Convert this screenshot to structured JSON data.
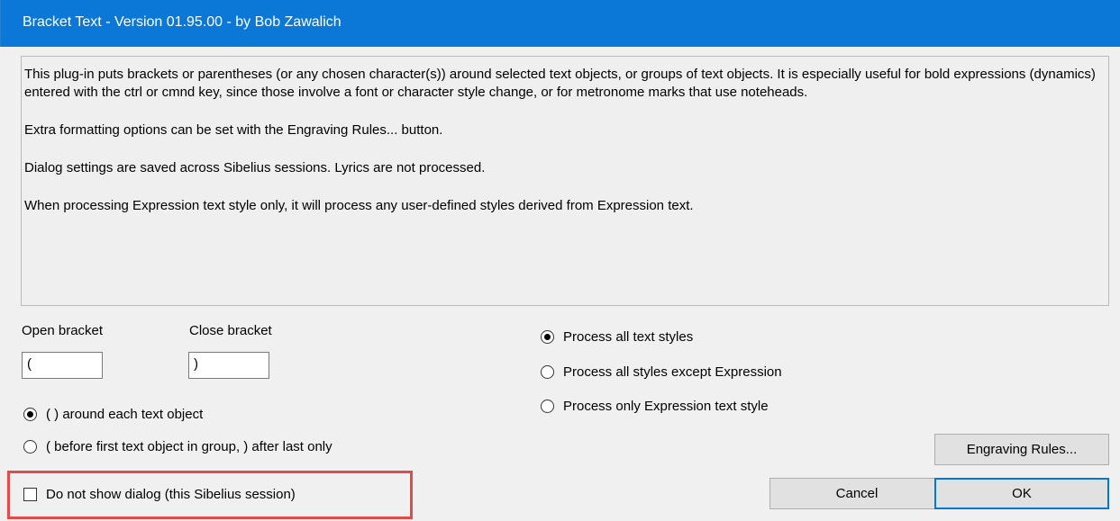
{
  "window": {
    "title": "Bracket Text - Version 01.95.00 - by Bob Zawalich"
  },
  "description": {
    "paragraphs": [
      "This plug-in puts brackets or parentheses (or any chosen character(s)) around selected text objects, or groups of text objects. It is especially useful for bold expressions (dynamics) entered with the ctrl or cmnd key, since those involve a font or character style change, or for metronome marks that use noteheads.",
      "Extra formatting options can be set with the Engraving Rules... button.",
      "Dialog settings are saved across Sibelius sessions. Lyrics are not processed.",
      "When processing Expression text style only, it will process any user-defined styles derived from Expression text."
    ]
  },
  "brackets": {
    "open_label": "Open bracket",
    "open_value": "(",
    "close_label": "Close bracket",
    "close_value": ")"
  },
  "placement": {
    "options": [
      {
        "label": "( ) around each text object",
        "selected": true
      },
      {
        "label": "( before first text object in group, ) after last only",
        "selected": false
      }
    ]
  },
  "styles": {
    "options": [
      {
        "label": "Process all text styles",
        "selected": true
      },
      {
        "label": "Process all styles except Expression",
        "selected": false
      },
      {
        "label": "Process only Expression text style",
        "selected": false
      }
    ]
  },
  "dont_show": {
    "label": "Do not show dialog (this Sibelius session)",
    "checked": false
  },
  "buttons": {
    "engraving_rules": "Engraving Rules...",
    "cancel": "Cancel",
    "ok": "OK"
  },
  "colors": {
    "titlebar": "#0b78d7",
    "highlight_box": "#e34b4b",
    "default_button_border": "#0078d7"
  }
}
